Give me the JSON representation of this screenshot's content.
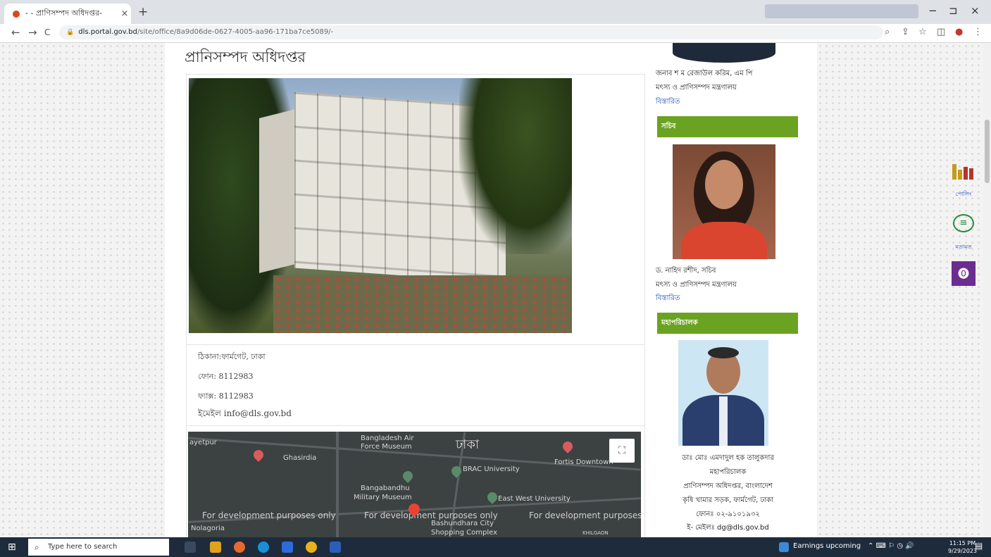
{
  "browser": {
    "tab_title": "- - প্রাণিসম্পদ অধিদপ্তর-",
    "tab_close": "×",
    "new_tab": "+",
    "url_host": "dls.portal.gov.bd",
    "url_path": "/site/office/8a9d06de-0627-4005-aa96-171ba7ce5089/-",
    "back": "←",
    "forward": "→",
    "reload": "C",
    "min": "−",
    "restore": "⊐",
    "close": "×"
  },
  "page": {
    "title": "প্রানিসম্পদ অধিদপ্তর",
    "address": "ঠিকানা:ফার্মগেট, ঢাকা",
    "phone": "ফোন: 8112983",
    "fax": "ফ্যাক্স: 8112983",
    "email": "ইমেইল info@dls.gov.bd"
  },
  "map": {
    "labels": [
      "ayetpur",
      "Ghasirdia",
      "Bangladesh Air",
      "Force Museum",
      "ঢাকা",
      "BRAC University",
      "Fortis Downtown",
      "Bangabandhu",
      "Military Museum",
      "East West University",
      "Bashundhara City",
      "Shopping Complex",
      "Nolagoria",
      "KHILGAON"
    ],
    "dev_text": [
      "For development purposes only",
      "For development purposes only",
      "For development purposes"
    ],
    "fullscreen": "⛶"
  },
  "sidebar": {
    "minister_name": "জনাব শ ম রেজাউল করিম, এম পি",
    "minister_ministry": "মৎস্য ও প্রাণিসম্পদ মন্ত্রণালয়",
    "more1": "বিস্তারিত",
    "secretary_header": "সচিব",
    "secretary_name": "ড. নাহিদ রশীদ, সচিব",
    "secretary_ministry": "মৎস্য ও প্রাণিসম্পদ মন্ত্রণালয়",
    "more2": "বিস্তারিত",
    "dg_header": "মহাপরিচালক",
    "dg_name": "ডাঃ মোঃ এমদাদুল হক তালুকদার",
    "dg_title": "মহাপরিচালক",
    "dg_office": "প্রাণিসম্পদ অধিদপ্তর, বাংলাদেশ",
    "dg_addr": "কৃষি খামার সড়ক, ফার্মগেট, ঢাকা",
    "dg_phone": "ফোনঃ ০২-৯১০১৯৩২",
    "dg_email": "ই- মেইলঃ dg@dls.gov.bd"
  },
  "floating": {
    "poll_label": "পোলিং",
    "feedback_label": "মতামত"
  },
  "taskbar": {
    "search_placeholder": "Type here to search",
    "news": "Earnings upcoming",
    "time": "11:15 PM",
    "date": "9/29/2023"
  },
  "colors": {
    "green_header": "#6aa321",
    "link": "#1a4dbf",
    "access": "#6b2d8f"
  }
}
